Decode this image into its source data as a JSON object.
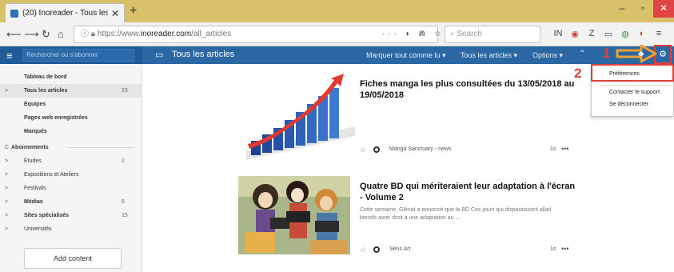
{
  "browser": {
    "tab_title": "(20) Inoreader - Tous les articl",
    "tab_close": "✕",
    "new_tab": "+",
    "window_controls": [
      "–",
      "▫",
      "✕"
    ],
    "url_prefix": "https://www.",
    "url_domain": "inoreader.com",
    "url_path": "/all_articles",
    "url_actions": "··· ◗ ⋒ ☆",
    "search_placeholder": "Search",
    "toolbar_icons": [
      "book-icon",
      "pocket-icon",
      "zotero-icon",
      "sidebar-icon",
      "extension-icon",
      "shield-icon",
      "menu-icon"
    ],
    "toolbar_glyphs": [
      "IN",
      "◉",
      "Z",
      "▭",
      "◍",
      "◐",
      "≡"
    ]
  },
  "app": {
    "sidebar_search_placeholder": "Rechercher ou s'abonner",
    "header_title": "Tous les articles",
    "header_actions": [
      "Marquer tout comme lu ▾",
      "Tous les articles ▾",
      "Options ▾"
    ],
    "header_caret": "⌃",
    "gear_glyph": "⚙"
  },
  "sidebar": {
    "items": [
      {
        "label": "Tableau de bord",
        "count": ""
      },
      {
        "label": "Tous les articles",
        "count": "23",
        "caret": ">"
      },
      {
        "label": "Equipes",
        "count": ""
      },
      {
        "label": "Pages web enregistrées",
        "count": ""
      },
      {
        "label": "Marqués",
        "count": ""
      },
      {
        "label": "Abonnements",
        "count": "",
        "caret": "C"
      },
      {
        "label": "Etudes",
        "count": "2",
        "caret": ">"
      },
      {
        "label": "Expositions et Ateliers",
        "count": "",
        "caret": ">"
      },
      {
        "label": "Festivals",
        "count": "",
        "caret": ">"
      },
      {
        "label": "Médias",
        "count": "6",
        "caret": ">"
      },
      {
        "label": "Sites spécialisés",
        "count": "15",
        "caret": ">"
      },
      {
        "label": "Universités",
        "count": "",
        "caret": ">"
      }
    ],
    "add_content": "Add content"
  },
  "articles": [
    {
      "title": "Fiches manga les plus consultées du 13/05/2018 au 19/05/2018",
      "snippet": "",
      "source": "Manga Sanctuary - news",
      "age": "1s",
      "more": "•••"
    },
    {
      "title": "Quatre BD qui mériteraient leur adaptation à l'écran - Volume 2",
      "snippet": "Cette semaine, Glénat a annoncé que la BD Ces jours qui disparaissent allait bientôt avoir droit à une adaptation au ...",
      "source": "Sens Art",
      "age": "1s",
      "more": "•••"
    }
  ],
  "dropdown": {
    "items": [
      "Préférences",
      "Contacter le support",
      "Se déconnecter"
    ]
  },
  "annotations": {
    "step1": "1",
    "step2": "2"
  },
  "colors": {
    "brand_blue": "#2b67a3",
    "highlight_red": "#e0403a",
    "annotation_orange": "#f0a030"
  }
}
